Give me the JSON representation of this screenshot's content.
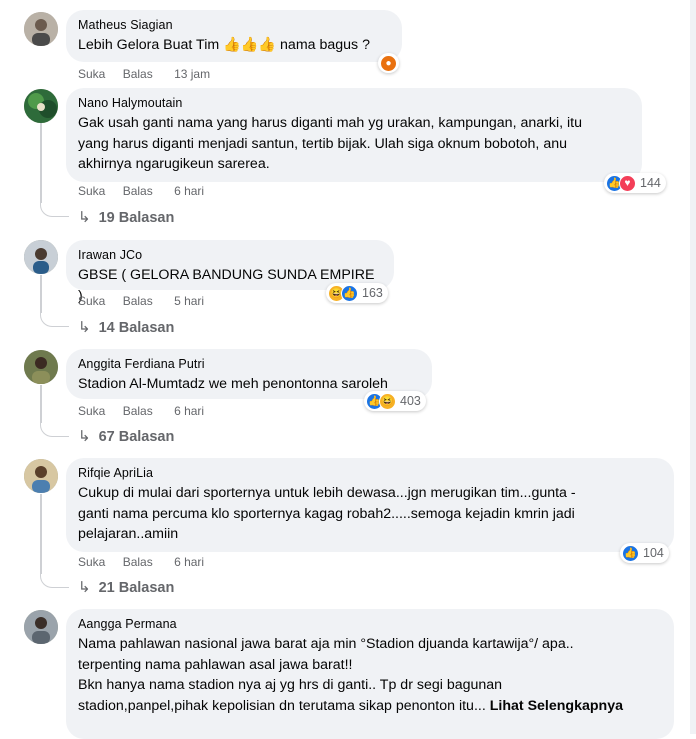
{
  "comments": [
    {
      "author": "Matheus Siagian",
      "text": "Lebih Gelora Buat Tim 👍👍👍 nama bagus ?",
      "like": "Suka",
      "reply": "Balas",
      "time": "13 jam",
      "reactions": [
        "angry"
      ],
      "count": ""
    },
    {
      "author": "Nano Halymoutain",
      "text": "Gak usah ganti nama yang harus diganti mah yg urakan, kampungan, anarki, itu\nyang harus diganti menjadi santun, tertib bijak. Ulah siga oknum bobotoh, anu\nakhirnya ngarugikeun sarerea.",
      "like": "Suka",
      "reply": "Balas",
      "time": "6 hari",
      "reactions": [
        "like",
        "love"
      ],
      "count": "144",
      "replies": "19 Balasan"
    },
    {
      "author": "Irawan JCo",
      "text": "GBSE ( GELORA BANDUNG SUNDA EMPIRE )",
      "like": "Suka",
      "reply": "Balas",
      "time": "5 hari",
      "reactions": [
        "haha",
        "like"
      ],
      "count": "163",
      "replies": "14 Balasan"
    },
    {
      "author": "Anggita Ferdiana Putri",
      "text": "Stadion Al-Mumtadz we meh penontonna saroleh",
      "like": "Suka",
      "reply": "Balas",
      "time": "6 hari",
      "reactions": [
        "like",
        "haha"
      ],
      "count": "403",
      "replies": "67 Balasan"
    },
    {
      "author": "Rifqie ApriLia",
      "text": "Cukup di mulai dari sporternya untuk lebih dewasa...jgn merugikan tim...gunta -\nganti nama percuma klo sporternya kagag robah2.....semoga kejadin kmrin jadi\npelajaran..amiin",
      "like": "Suka",
      "reply": "Balas",
      "time": "6 hari",
      "reactions": [
        "like"
      ],
      "count": "104",
      "replies": "21 Balasan"
    },
    {
      "author": "Aangga Permana",
      "text": "Nama pahlawan nasional jawa barat aja min °Stadion djuanda kartawija°/ apa..\nterpenting nama pahlawan asal jawa barat!!\nBkn hanya nama stadion nya aj yg hrs di ganti.. Tp dr segi bagunan\nstadion,panpel,pihak kepolisian dn terutama sikap penonton itu...",
      "more": "Lihat Selengkapnya"
    }
  ]
}
